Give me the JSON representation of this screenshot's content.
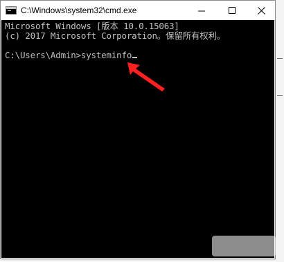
{
  "window": {
    "title": "C:\\Windows\\system32\\cmd.exe",
    "controls": {
      "minimize": "minimize-icon",
      "maximize": "maximize-icon",
      "close": "close-icon"
    }
  },
  "console": {
    "lines": [
      "Microsoft Windows [版本 10.0.15063]",
      "(c) 2017 Microsoft Corporation。保留所有权利。",
      "",
      "C:\\Users\\Admin>systeminfo"
    ],
    "text_color": "#c0c0c0",
    "background_color": "#000000"
  },
  "annotation": {
    "arrow_color": "#ff2020"
  }
}
